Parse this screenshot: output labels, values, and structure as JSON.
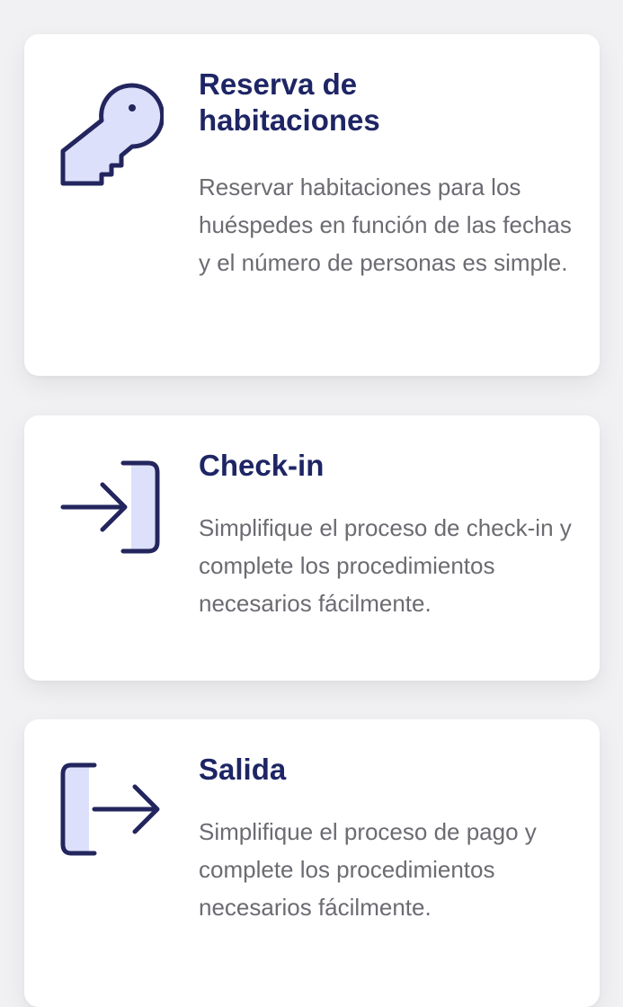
{
  "colors": {
    "navy": "#1e2565",
    "icon_fill": "#dde0fb",
    "text_gray": "#6b6b72",
    "card_bg": "#ffffff",
    "page_bg": "#f1f1f3"
  },
  "features": [
    {
      "icon": "key-icon",
      "title": "Reserva de habitaciones",
      "description": "Reservar habitaciones para los huéspedes en función de las fechas y el número de personas es simple."
    },
    {
      "icon": "check-in-icon",
      "title": "Check-in",
      "description": "Simplifique el proceso de check-in y complete los procedimientos necesarios fácilmente."
    },
    {
      "icon": "check-out-icon",
      "title": "Salida",
      "description": "Simplifique el proceso de pago y complete los procedimientos necesarios fácilmente."
    }
  ]
}
